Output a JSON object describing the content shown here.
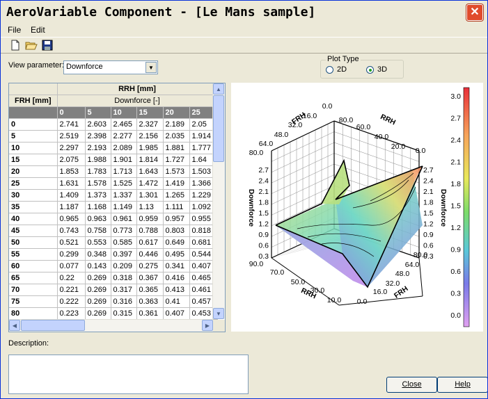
{
  "window": {
    "title": "AeroVariable Component - [Le Mans sample]"
  },
  "menu": [
    {
      "label": "File"
    },
    {
      "label": "Edit"
    }
  ],
  "toolbar": {
    "icons": [
      "new-file-icon",
      "open-folder-icon",
      "save-disk-icon"
    ]
  },
  "view_parameter": {
    "label": "View parameter:",
    "value": "Downforce"
  },
  "plot_type": {
    "title": "Plot Type",
    "options": [
      "2D",
      "3D"
    ],
    "selected": "3D"
  },
  "table": {
    "header_top": "RRH [mm]",
    "row_header_label": "FRH [mm]",
    "subheader": "Downforce [-]",
    "columns": [
      "0",
      "5",
      "10",
      "15",
      "20",
      "25"
    ],
    "rows": [
      {
        "frh": "0",
        "values": [
          "2.741",
          "2.603",
          "2.465",
          "2.327",
          "2.189",
          "2.05"
        ]
      },
      {
        "frh": "5",
        "values": [
          "2.519",
          "2.398",
          "2.277",
          "2.156",
          "2.035",
          "1.914"
        ]
      },
      {
        "frh": "10",
        "values": [
          "2.297",
          "2.193",
          "2.089",
          "1.985",
          "1.881",
          "1.777"
        ]
      },
      {
        "frh": "15",
        "values": [
          "2.075",
          "1.988",
          "1.901",
          "1.814",
          "1.727",
          "1.64"
        ]
      },
      {
        "frh": "20",
        "values": [
          "1.853",
          "1.783",
          "1.713",
          "1.643",
          "1.573",
          "1.503"
        ]
      },
      {
        "frh": "25",
        "values": [
          "1.631",
          "1.578",
          "1.525",
          "1.472",
          "1.419",
          "1.366"
        ]
      },
      {
        "frh": "30",
        "values": [
          "1.409",
          "1.373",
          "1.337",
          "1.301",
          "1.265",
          "1.229"
        ]
      },
      {
        "frh": "35",
        "values": [
          "1.187",
          "1.168",
          "1.149",
          "1.13",
          "1.111",
          "1.092"
        ]
      },
      {
        "frh": "40",
        "values": [
          "0.965",
          "0.963",
          "0.961",
          "0.959",
          "0.957",
          "0.955"
        ]
      },
      {
        "frh": "45",
        "values": [
          "0.743",
          "0.758",
          "0.773",
          "0.788",
          "0.803",
          "0.818"
        ]
      },
      {
        "frh": "50",
        "values": [
          "0.521",
          "0.553",
          "0.585",
          "0.617",
          "0.649",
          "0.681"
        ]
      },
      {
        "frh": "55",
        "values": [
          "0.299",
          "0.348",
          "0.397",
          "0.446",
          "0.495",
          "0.544"
        ]
      },
      {
        "frh": "60",
        "values": [
          "0.077",
          "0.143",
          "0.209",
          "0.275",
          "0.341",
          "0.407"
        ]
      },
      {
        "frh": "65",
        "values": [
          "0.22",
          "0.269",
          "0.318",
          "0.367",
          "0.416",
          "0.465"
        ]
      },
      {
        "frh": "70",
        "values": [
          "0.221",
          "0.269",
          "0.317",
          "0.365",
          "0.413",
          "0.461"
        ]
      },
      {
        "frh": "75",
        "values": [
          "0.222",
          "0.269",
          "0.316",
          "0.363",
          "0.41",
          "0.457"
        ]
      },
      {
        "frh": "80",
        "values": [
          "0.223",
          "0.269",
          "0.315",
          "0.361",
          "0.407",
          "0.453"
        ]
      }
    ]
  },
  "plot": {
    "frh_ticks_top": [
      "80.0",
      "64.0",
      "48.0",
      "32.0",
      "16.0",
      "0.0"
    ],
    "rrh_ticks_top": [
      "80.0",
      "60.0",
      "40.0",
      "20.0",
      "0.0"
    ],
    "rrh_ticks_bottom": [
      "90.0",
      "70.0",
      "50.0",
      "30.0",
      "10.0"
    ],
    "frh_ticks_bottom": [
      "0.0",
      "16.0",
      "32.0",
      "48.0",
      "64.0",
      "80.0"
    ],
    "z_ticks": [
      "2.7",
      "2.4",
      "2.1",
      "1.8",
      "1.5",
      "1.2",
      "0.9",
      "0.6",
      "0.3"
    ],
    "axis_labels": {
      "frh": "FRH",
      "rrh": "RRH",
      "z": "Downforce"
    },
    "colorbar_ticks": [
      "3.0",
      "2.7",
      "2.4",
      "2.1",
      "1.8",
      "1.5",
      "1.2",
      "0.9",
      "0.6",
      "0.3",
      "0.0"
    ]
  },
  "description": {
    "label": "Description:"
  },
  "buttons": {
    "close": "Close",
    "help": "Help"
  }
}
